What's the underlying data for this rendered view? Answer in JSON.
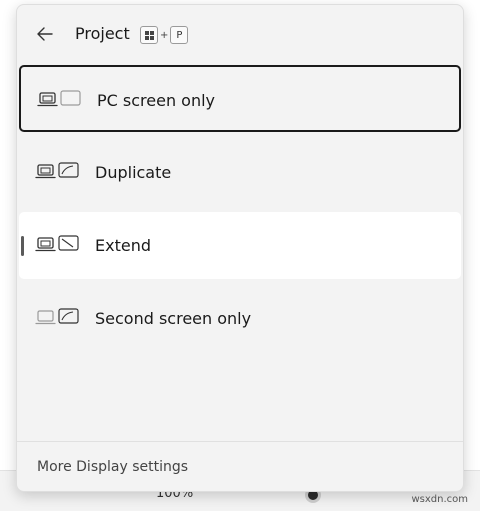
{
  "header": {
    "title": "Project",
    "shortcut_key": "P",
    "shortcut_plus": "+"
  },
  "options": [
    {
      "label": "PC screen only",
      "state": "selected"
    },
    {
      "label": "Duplicate",
      "state": "normal"
    },
    {
      "label": "Extend",
      "state": "active"
    },
    {
      "label": "Second screen only",
      "state": "normal"
    }
  ],
  "footer": {
    "link_label": "More Display settings"
  },
  "background": {
    "zoom_label": "100%"
  },
  "watermark": "wsxdn.com",
  "colors": {
    "panel_bg": "#f3f3f3",
    "hover_bg": "#ffffff",
    "selected_border": "#1a1a1a",
    "indicator": "#5a5a5a"
  }
}
